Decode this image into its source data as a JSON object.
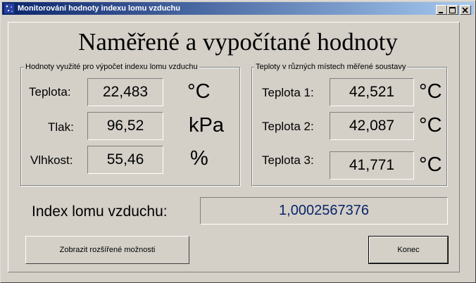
{
  "window": {
    "title": "Monitorování hodnoty indexu lomu vzduchu"
  },
  "heading": "Naměřené a vypočítané hodnoty",
  "left_group": {
    "legend": "Hodnoty využité pro výpočet indexu lomu vzduchu",
    "rows": [
      {
        "label": "Teplota:",
        "value": "22,483",
        "unit": "°C"
      },
      {
        "label": "Tlak:",
        "value": "96,52",
        "unit": "kPa"
      },
      {
        "label": "Vlhkost:",
        "value": "55,46",
        "unit": "%"
      }
    ]
  },
  "right_group": {
    "legend": "Teploty v různých místech měřené soustavy",
    "rows": [
      {
        "label": "Teplota 1:",
        "value": "42,521",
        "unit": "°C"
      },
      {
        "label": "Teplota 2:",
        "value": "42,087",
        "unit": "°C"
      },
      {
        "label": "Teplota 3:",
        "value": "41,771",
        "unit": "°C"
      }
    ]
  },
  "index": {
    "label": "Index lomu vzduchu:",
    "value": "1,0002567376"
  },
  "buttons": {
    "advanced": "Zobrazit rozšířené možnosti",
    "close": "Konec"
  }
}
